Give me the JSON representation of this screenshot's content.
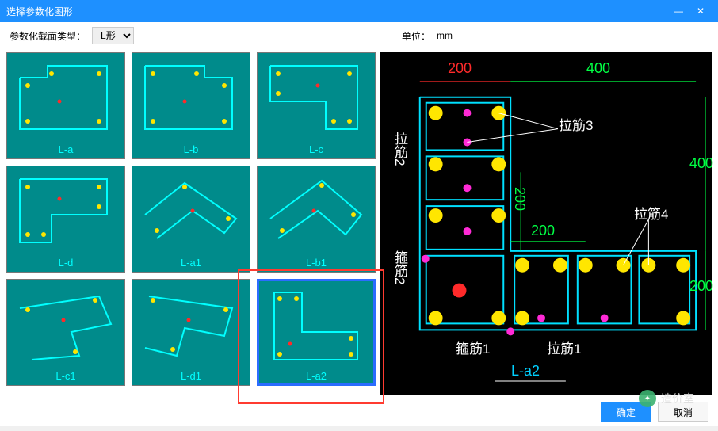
{
  "window": {
    "title": "选择参数化图形",
    "min": "—",
    "close": "✕"
  },
  "toolbar": {
    "type_label": "参数化截面类型：",
    "type_value": "L形",
    "unit_label": "单位：",
    "unit_value": "mm"
  },
  "thumbs": [
    {
      "id": "L-a",
      "label": "L-a"
    },
    {
      "id": "L-b",
      "label": "L-b"
    },
    {
      "id": "L-c",
      "label": "L-c"
    },
    {
      "id": "L-d",
      "label": "L-d"
    },
    {
      "id": "L-a1",
      "label": "L-a1"
    },
    {
      "id": "L-b1",
      "label": "L-b1"
    },
    {
      "id": "L-c1",
      "label": "L-c1"
    },
    {
      "id": "L-d1",
      "label": "L-d1"
    },
    {
      "id": "L-a2",
      "label": "L-a2"
    }
  ],
  "selected": "L-a2",
  "preview": {
    "dims": {
      "top_left": "200",
      "top_right": "400",
      "right_top": "400",
      "right_bottom": "200",
      "mid_v": "200",
      "mid_h": "200"
    },
    "labels": {
      "lajin1": "拉筋1",
      "lajin2": "拉筋2",
      "lajin3": "拉筋3",
      "lajin4": "拉筋4",
      "gujin1": "箍筋1",
      "gujin2": "箍筋2",
      "name": "L-a2"
    }
  },
  "buttons": {
    "ok": "确定",
    "cancel": "取消"
  },
  "watermark": "造价室"
}
